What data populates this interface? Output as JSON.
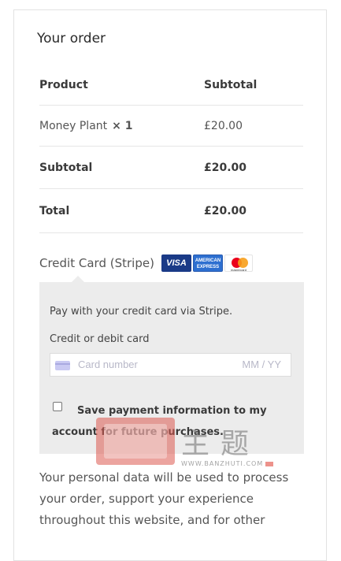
{
  "order": {
    "title": "Your order",
    "header": {
      "product": "Product",
      "subtotal": "Subtotal"
    },
    "item": {
      "name": "Money Plant",
      "qty": "× 1",
      "price": "£20.00"
    },
    "subtotal": {
      "label": "Subtotal",
      "value": "£20.00"
    },
    "total": {
      "label": "Total",
      "value": "£20.00"
    }
  },
  "payment": {
    "method_label": "Credit Card (Stripe)",
    "logos": {
      "visa": "VISA",
      "amex_line1": "AMERICAN",
      "amex_line2": "EXPRESS",
      "mastercard": "mastercard"
    },
    "description": "Pay with your credit card via Stripe.",
    "card_field_label": "Credit or debit card",
    "card_number_placeholder": "Card number",
    "expiry_placeholder": "MM / YY",
    "save_info_label": "Save payment information to my account for future purchases."
  },
  "watermark": {
    "chars": "主题",
    "url": "WWW.BANZHUTI.COM"
  },
  "privacy": {
    "text": "Your personal data will be used to process your order, support your experience throughout this website, and for other"
  }
}
